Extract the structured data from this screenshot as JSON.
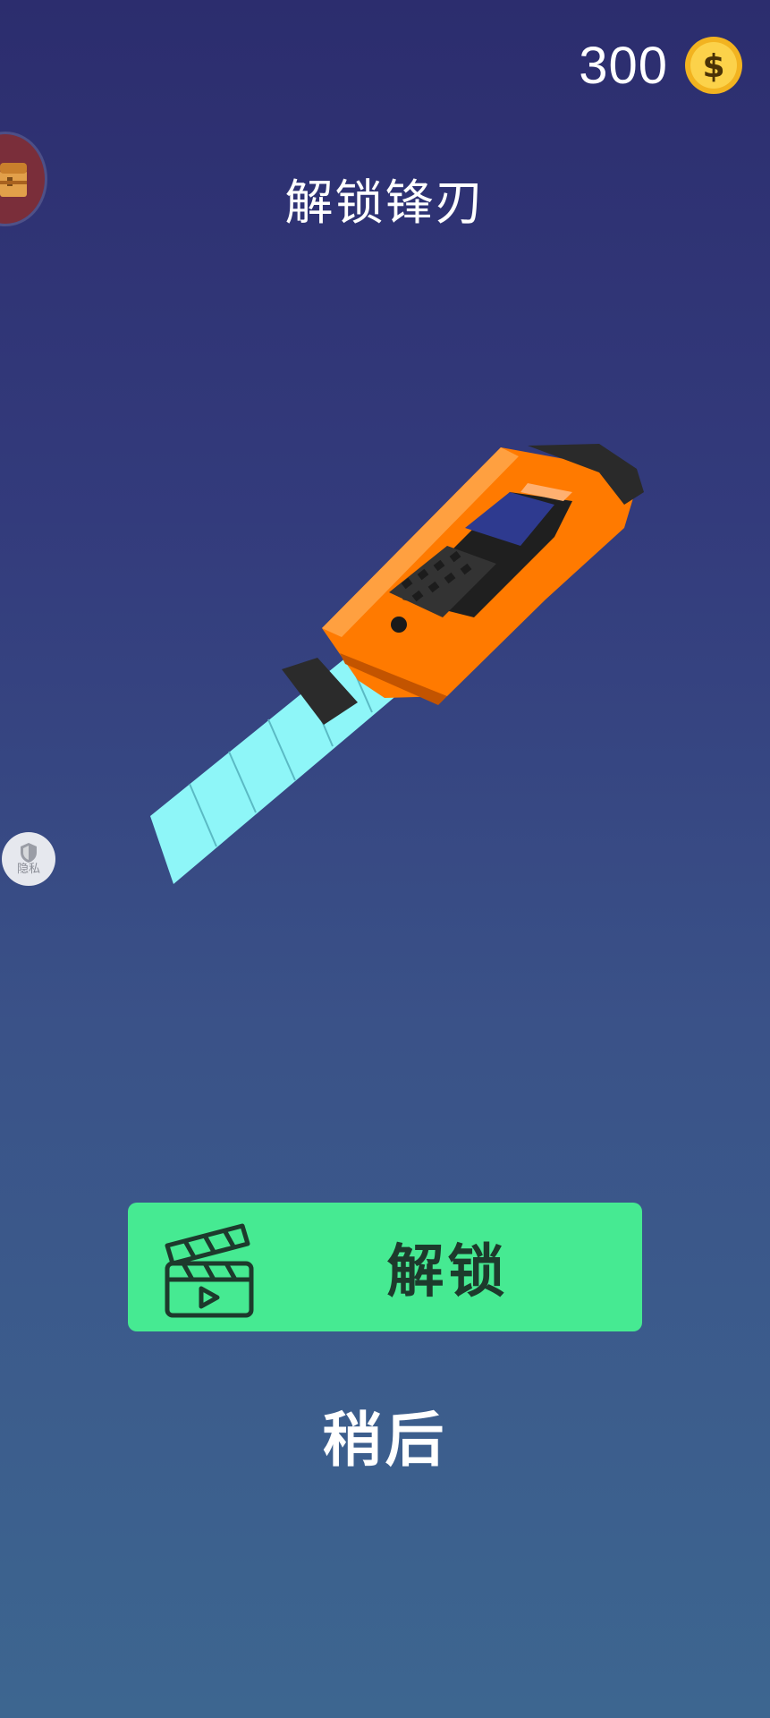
{
  "header": {
    "coin_count": "300",
    "coin_icon": "dollar-coin-icon",
    "title": "解锁锋刃"
  },
  "side": {
    "chest_icon": "treasure-chest-icon",
    "privacy_label": "隐私",
    "privacy_icon": "shield-icon"
  },
  "item": {
    "name": "utility-knife",
    "handle_color": "#ff7a00",
    "blade_color": "#8ef6f8"
  },
  "actions": {
    "unlock_label": "解锁",
    "unlock_icon": "video-clapperboard-icon",
    "unlock_color": "#46ea92",
    "later_label": "稍后"
  }
}
